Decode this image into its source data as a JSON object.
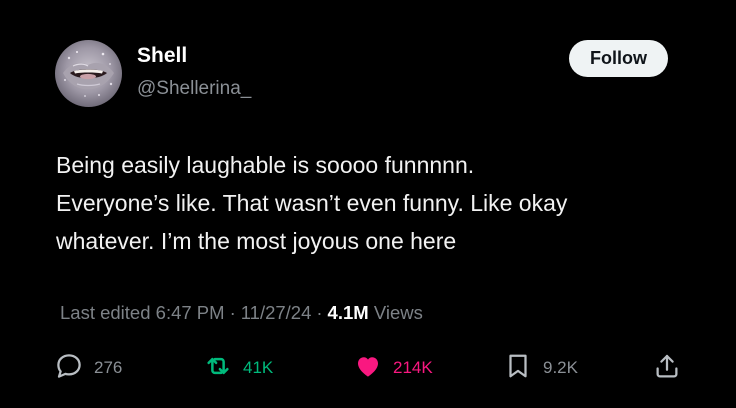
{
  "author": {
    "display_name": "Shell",
    "handle": "@Shellerina_"
  },
  "follow_label": "Follow",
  "tweet": {
    "lines": [
      "Being easily laughable is soooo funnnnn.",
      "Everyone’s like. That wasn’t even funny. Like okay",
      "whatever. I’m the most joyous one here"
    ]
  },
  "meta": {
    "edited_time": "Last edited 6:47 PM",
    "separator": "·",
    "date": "11/27/24",
    "separator2": "·",
    "views_count": "4.1M",
    "views_label": "Views"
  },
  "actions": {
    "reply_count": "276",
    "repost_count": "41K",
    "like_count": "214K",
    "bookmark_count": "9.2K"
  },
  "colors": {
    "background": "#000000",
    "repost_active": "#00ba7c",
    "like_active": "#f91880",
    "secondary_text": "#8b9096",
    "follow_button_bg": "#eff3f4"
  },
  "icons": {
    "reply": "speech-bubble-icon",
    "repost": "repost-arrows-icon",
    "like": "heart-icon",
    "bookmark": "bookmark-icon",
    "share": "share-upload-icon"
  }
}
